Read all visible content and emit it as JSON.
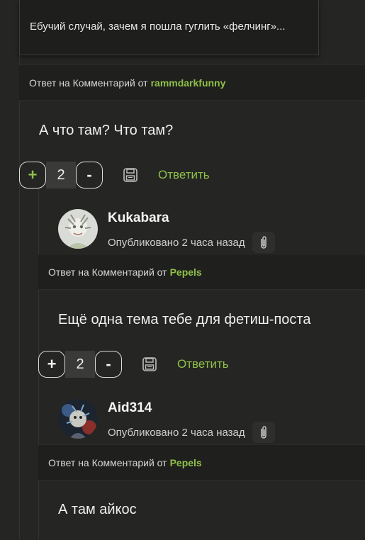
{
  "tooltip": {
    "text": "Ебучий случай, зачем я пошла гуглить «фелчинг»..."
  },
  "comments": [
    {
      "reply_prefix": "Ответ на Комментарий от",
      "reply_to": "rammdarkfunny",
      "text": "А что там? Что там?",
      "votes": "2",
      "plus": "+",
      "minus": "-",
      "reply_label": "Ответить"
    },
    {
      "username": "Kukabara",
      "published": "Опубликовано 2 часа назад",
      "reply_prefix": "Ответ на Комментарий от",
      "reply_to": "Pepels",
      "text": "Ещё одна тема тебе для фетиш-поста",
      "votes": "2",
      "plus": "+",
      "minus": "-",
      "reply_label": "Ответить"
    },
    {
      "username": "Aid314",
      "published": "Опубликовано 2 часа назад",
      "reply_prefix": "Ответ на Комментарий от",
      "reply_to": "Pepels",
      "text": "А там айкос"
    }
  ],
  "colors": {
    "accent": "#8fc04a",
    "background": "#252623",
    "bar": "#1f201d"
  },
  "icons": [
    "save-icon",
    "paperclip-icon",
    "avatar-kukabara",
    "avatar-aid314"
  ]
}
